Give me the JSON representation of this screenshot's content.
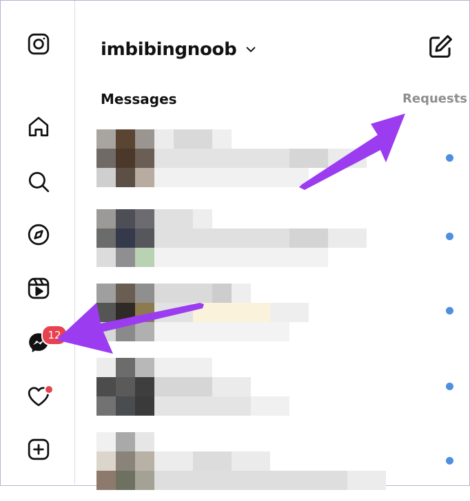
{
  "account": {
    "username": "imbibingnoob"
  },
  "tabs": {
    "messages": "Messages",
    "requests": "Requests"
  },
  "nav": {
    "items": [
      {
        "icon": "instagram-logo-icon"
      },
      {
        "icon": "home-icon"
      },
      {
        "icon": "search-icon"
      },
      {
        "icon": "explore-compass-icon"
      },
      {
        "icon": "reels-icon"
      },
      {
        "icon": "messenger-icon",
        "badge": "12"
      },
      {
        "icon": "notifications-heart-icon",
        "has_dot": true
      },
      {
        "icon": "create-plus-icon"
      }
    ]
  },
  "threads": [
    {
      "unread": true
    },
    {
      "unread": true
    },
    {
      "unread": true
    },
    {
      "unread": true
    },
    {
      "unread": true
    }
  ],
  "colors": {
    "accent_arrow": "#9b3cf0",
    "unread_dot": "#4f8fe0",
    "badge": "#e8414f"
  }
}
